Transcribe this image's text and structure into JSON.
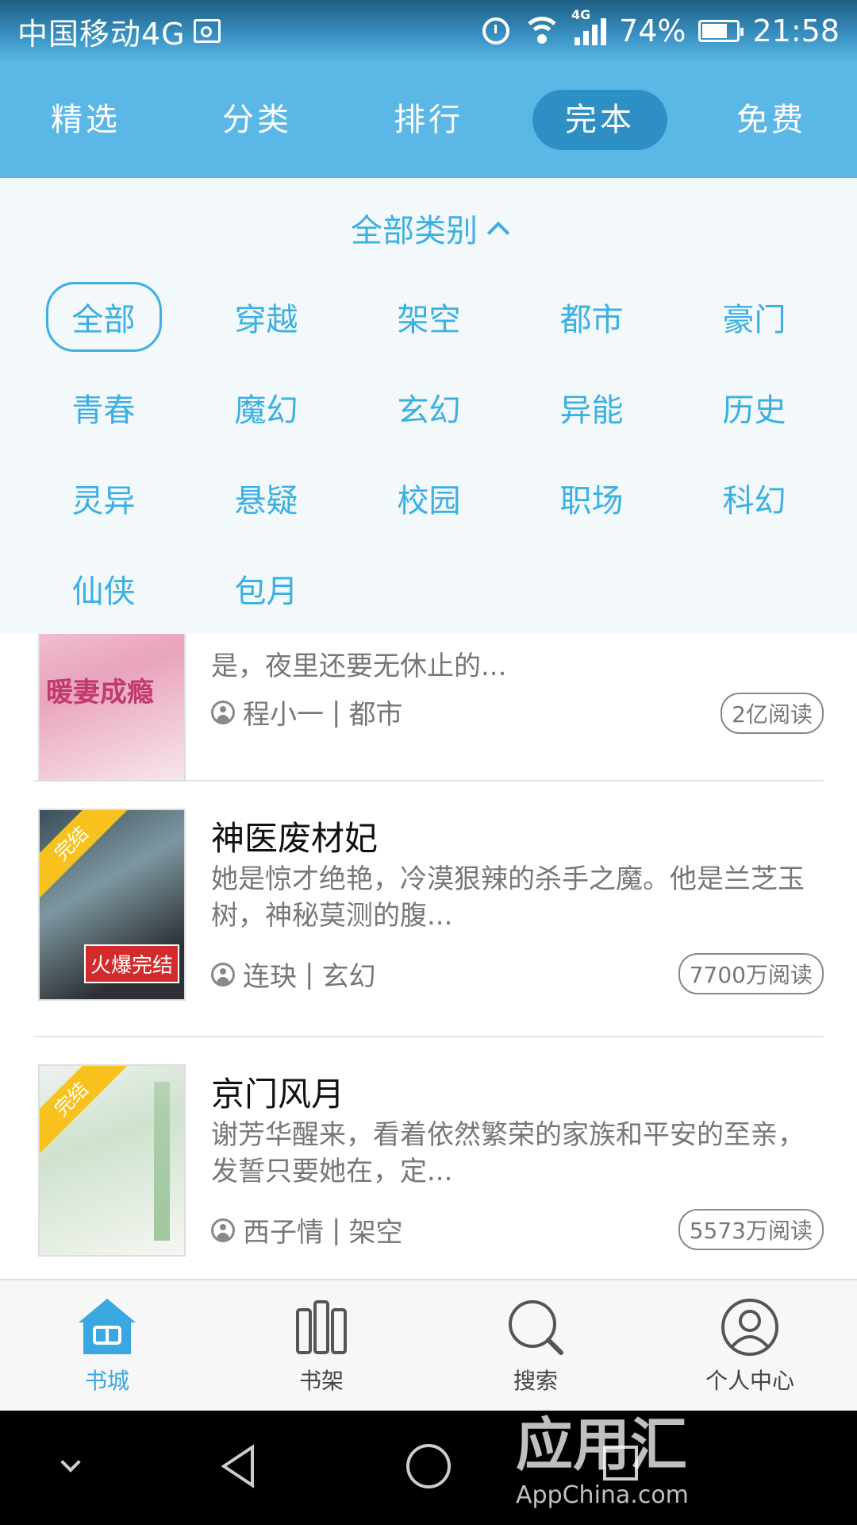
{
  "statusbar": {
    "carrier": "中国移动4G",
    "network": "4G",
    "battery": "74%",
    "battery_fraction": 0.74,
    "time": "21:58"
  },
  "topnav": {
    "tabs": [
      {
        "label": "精选",
        "active": false
      },
      {
        "label": "分类",
        "active": false
      },
      {
        "label": "排行",
        "active": false
      },
      {
        "label": "完本",
        "active": true
      },
      {
        "label": "免费",
        "active": false
      }
    ]
  },
  "category_panel": {
    "header": "全部类别",
    "items": [
      "全部",
      "穿越",
      "架空",
      "都市",
      "豪门",
      "青春",
      "魔幻",
      "玄幻",
      "异能",
      "历史",
      "灵异",
      "悬疑",
      "校园",
      "职场",
      "科幻",
      "仙侠",
      "包月"
    ],
    "selected": "全部"
  },
  "books": [
    {
      "title": "",
      "desc": "是，夜里还要无休止的...",
      "author": "程小一",
      "category": "都市",
      "reads": "2亿阅读",
      "cover_text": "暖妻成瘾",
      "ribbon": ""
    },
    {
      "title": "神医废材妃",
      "desc": "她是惊才绝艳，冷漠狠辣的杀手之魔。他是兰芝玉树，神秘莫测的腹...",
      "author": "连玦",
      "category": "玄幻",
      "reads": "7700万阅读",
      "cover_text": "火爆完结",
      "ribbon": "完结"
    },
    {
      "title": "京门风月",
      "desc": "谢芳华醒来，看着依然繁荣的家族和平安的至亲，发誓只要她在，定...",
      "author": "西子情",
      "category": "架空",
      "reads": "5573万阅读",
      "cover_text": "",
      "ribbon": "完结"
    }
  ],
  "tabbar": {
    "items": [
      {
        "label": "书城",
        "icon": "store-icon",
        "active": true
      },
      {
        "label": "书架",
        "icon": "bookshelf-icon",
        "active": false
      },
      {
        "label": "搜索",
        "icon": "search-icon",
        "active": false
      },
      {
        "label": "个人中心",
        "icon": "profile-icon",
        "active": false
      }
    ]
  },
  "watermark": {
    "text": "应用汇",
    "sub": "AppChina.com"
  },
  "colors": {
    "accent": "#5bb8e6",
    "active_tab_bg": "#2e8fc4",
    "category_text": "#3ab0e2",
    "ribbon": "#f7c21d"
  }
}
